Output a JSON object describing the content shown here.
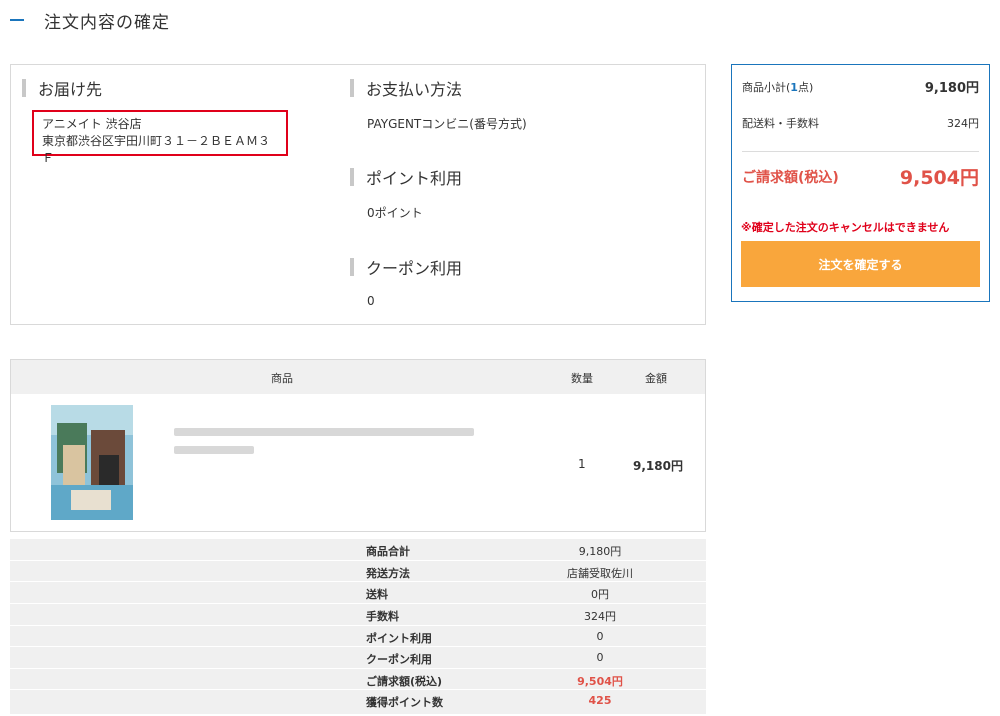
{
  "page": {
    "title": "注文内容の確定"
  },
  "delivery": {
    "heading": "お届け先",
    "store": "アニメイト 渋谷店",
    "address": "東京都渋谷区宇田川町３１－２ＢＥＡＭ３Ｆ"
  },
  "payment": {
    "heading": "お支払い方法",
    "value": "PAYGENTコンビニ(番号方式)"
  },
  "points": {
    "heading": "ポイント利用",
    "value": "0ポイント"
  },
  "coupon": {
    "heading": "クーポン利用",
    "value": "0"
  },
  "summary": {
    "subtotal_prefix": "商品小計(",
    "subtotal_count": "1",
    "subtotal_suffix": "点)",
    "subtotal_amount": "9,180円",
    "shipping_label": "配送料・手数料",
    "shipping_amount": "324円",
    "total_label": "ご請求額(税込)",
    "total_amount": "9,504円",
    "cancel_note": "※確定した注文のキャンセルはできません",
    "confirm_button": "注文を確定する"
  },
  "product_table": {
    "headers": {
      "item": "商品",
      "qty": "数量",
      "price": "金額"
    },
    "rows": [
      {
        "qty": "1",
        "price": "9,180円"
      }
    ]
  },
  "totals": [
    {
      "label": "商品合計",
      "value": "9,180円"
    },
    {
      "label": "発送方法",
      "value": "店舗受取佐川"
    },
    {
      "label": "送料",
      "value": "0円"
    },
    {
      "label": "手数料",
      "value": "324円"
    },
    {
      "label": "ポイント利用",
      "value": "0"
    },
    {
      "label": "クーポン利用",
      "value": "0"
    },
    {
      "label": "ご請求額(税込)",
      "value": "9,504円"
    },
    {
      "label": "獲得ポイント数",
      "value": "425"
    }
  ],
  "colors": {
    "accent": "#1a75bc",
    "highlight_red": "#e05248",
    "alert_red": "#e0001a",
    "button_orange": "#f9a63c"
  }
}
